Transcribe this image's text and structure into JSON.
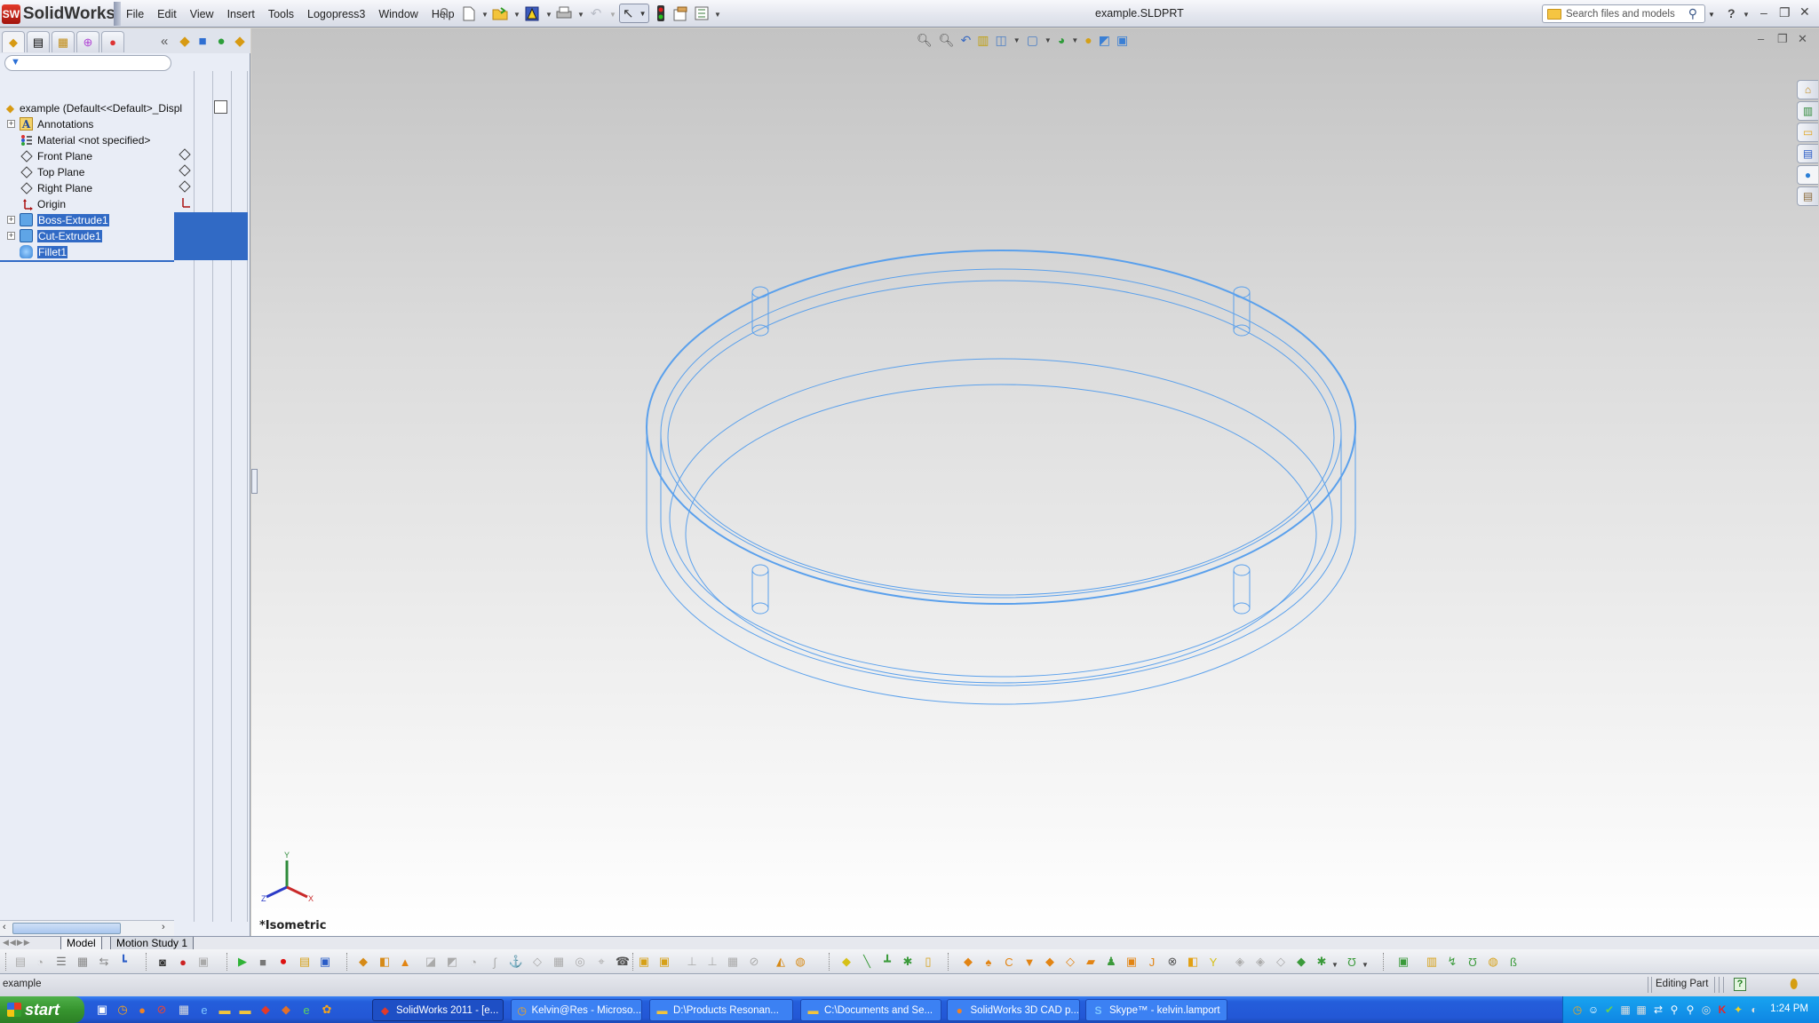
{
  "app": {
    "logo_text": "SolidWorks",
    "logo_badge": "SW",
    "document_title": "example.SLDPRT"
  },
  "menu": [
    "File",
    "Edit",
    "View",
    "Insert",
    "Tools",
    "Logopress3",
    "Window",
    "Help"
  ],
  "search": {
    "placeholder": "Search files and models"
  },
  "feature_tree": {
    "root": "example  (Default<<Default>_Displ",
    "items": [
      {
        "label": "Annotations",
        "icon": "annotations-icon",
        "expandable": true,
        "selected": false
      },
      {
        "label": "Material <not specified>",
        "icon": "material-icon",
        "expandable": false,
        "selected": false
      },
      {
        "label": "Front Plane",
        "icon": "plane-icon",
        "expandable": false,
        "selected": false
      },
      {
        "label": "Top Plane",
        "icon": "plane-icon",
        "expandable": false,
        "selected": false
      },
      {
        "label": "Right Plane",
        "icon": "plane-icon",
        "expandable": false,
        "selected": false
      },
      {
        "label": "Origin",
        "icon": "origin-icon",
        "expandable": false,
        "selected": false
      },
      {
        "label": "Boss-Extrude1",
        "icon": "boss-extrude-icon",
        "expandable": true,
        "selected": true
      },
      {
        "label": "Cut-Extrude1",
        "icon": "cut-extrude-icon",
        "expandable": true,
        "selected": true
      },
      {
        "label": "Fillet1",
        "icon": "fillet-icon",
        "expandable": false,
        "selected": true
      }
    ]
  },
  "viewport": {
    "view_name": "*Isometric",
    "triad": {
      "x": "X",
      "y": "Y",
      "z": "Z"
    },
    "model_color": "#5aa0ec"
  },
  "bottom_tabs": [
    "Model",
    "Motion Study 1"
  ],
  "status_bar": {
    "left": "example",
    "mode": "Editing Part",
    "help": "?"
  },
  "taskbar": {
    "start_label": "start",
    "tasks": [
      {
        "label": "SolidWorks 2011 - [e...",
        "icon": "solidworks-icon",
        "active": true
      },
      {
        "label": "Kelvin@Res - Microso...",
        "icon": "outlook-icon",
        "active": false
      },
      {
        "label": "D:\\Products Resonan...",
        "icon": "folder-icon",
        "active": false
      },
      {
        "label": "C:\\Documents and Se...",
        "icon": "folder-icon",
        "active": false
      },
      {
        "label": "SolidWorks 3D CAD p...",
        "icon": "firefox-icon",
        "active": false
      },
      {
        "label": "Skype™ - kelvin.lamport",
        "icon": "skype-icon",
        "active": false
      }
    ],
    "clock": "1:24 PM"
  },
  "colors": {
    "selection": "#316ac5",
    "wireframe": "#5aa0ec",
    "taskbar": "#245edb",
    "start": "#37952f"
  }
}
